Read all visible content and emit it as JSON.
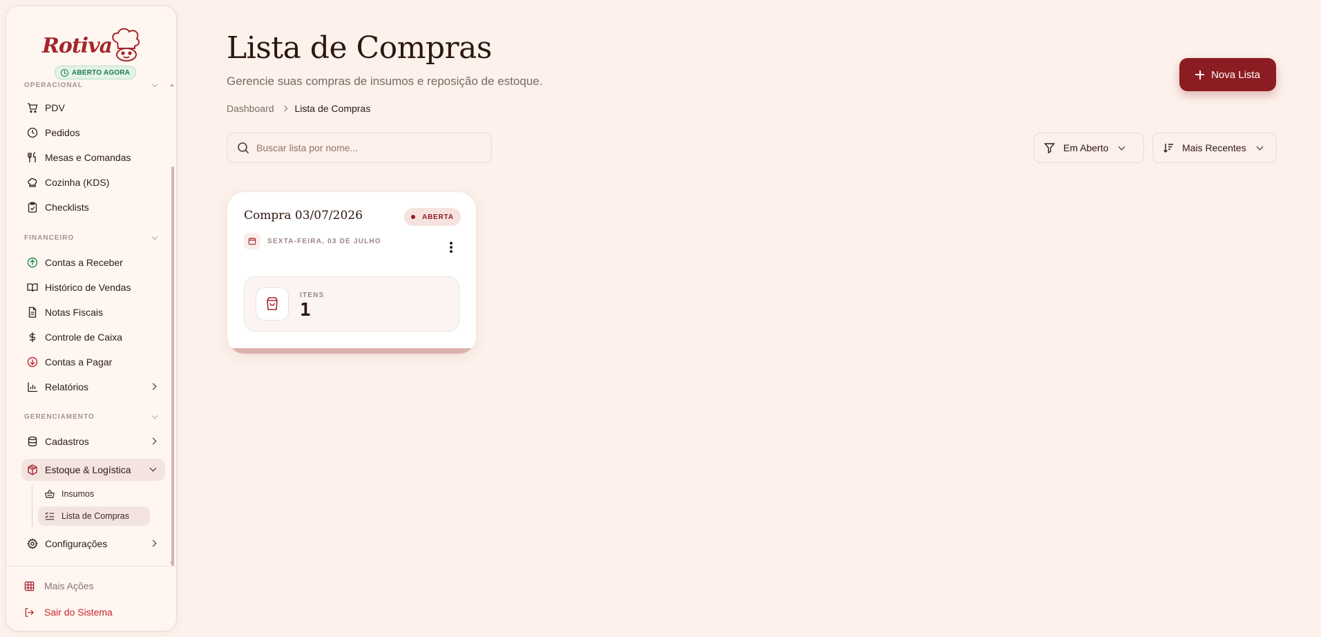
{
  "brand": {
    "name": "Rotiva",
    "status": "ABERTO AGORA"
  },
  "sidebar": {
    "sections": [
      {
        "title": "OPERACIONAL",
        "items": [
          "PDV",
          "Pedidos",
          "Mesas e Comandas",
          "Cozinha (KDS)",
          "Checklists"
        ]
      },
      {
        "title": "FINANCEIRO",
        "items": [
          "Contas a Receber",
          "Histórico de Vendas",
          "Notas Fiscais",
          "Controle de Caixa",
          "Contas a Pagar",
          "Relatórios"
        ]
      },
      {
        "title": "GERENCIAMENTO",
        "items": [
          "Cadastros",
          "Estoque & Logística",
          "Configurações"
        ]
      }
    ],
    "subitems": [
      "Insumos",
      "Lista de Compras"
    ],
    "footer": {
      "more": "Mais Ações",
      "logout": "Sair do Sistema"
    }
  },
  "header": {
    "title": "Lista de Compras",
    "subtitle": "Gerencie suas compras de insumos e reposição de estoque.",
    "breadcrumb": [
      "Dashboard",
      "Lista de Compras"
    ],
    "new_button": "Nova Lista"
  },
  "toolbar": {
    "search_placeholder": "Buscar lista por nome...",
    "filter_label": "Em Aberto",
    "sort_label": "Mais Recentes"
  },
  "lists": [
    {
      "title": "Compra 03/07/2026",
      "status": "ABERTA",
      "date": "SEXTA-FEIRA, 03 DE JULHO",
      "items_label": "ITENS",
      "items_count": "1"
    }
  ],
  "colors": {
    "accent": "#8b1d22",
    "background": "#fdf1eb",
    "success": "#1f7a45",
    "danger": "#c0282e"
  }
}
